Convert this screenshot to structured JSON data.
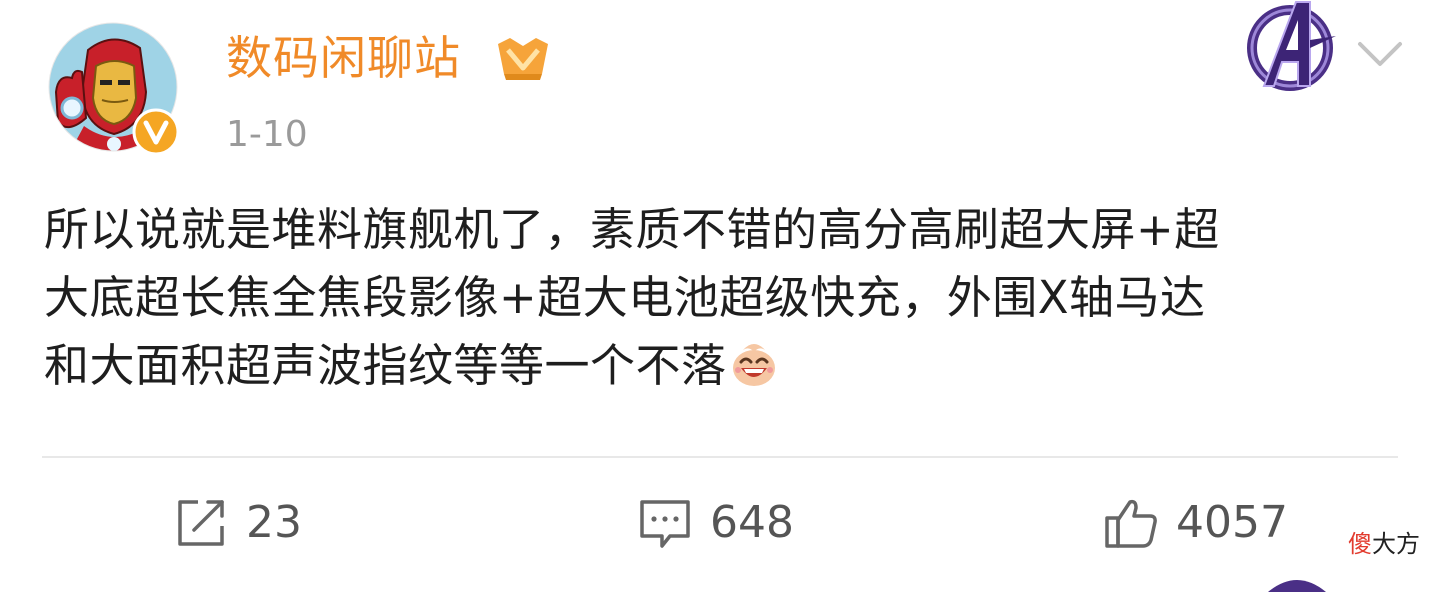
{
  "post": {
    "author": {
      "name": "数码闲聊站",
      "avatar_icon": "iron-man-avatar",
      "verified_badge_icon": "verified-v-badge",
      "vip_icon": "vip-crown-icon"
    },
    "timestamp": "1-10",
    "header_badge_icon": "avengers-logo-badge",
    "menu_icon": "chevron-down-icon",
    "content_lines": [
      "所以说就是堆料旗舰机了，素质不错的高分高刷超大屏+超",
      "大底超长焦全焦段影像+超大电池超级快充，外围X轴马达",
      "和大面积超声波指纹等等一个不落"
    ],
    "content_emoji_icon": "laughing-face-emoji",
    "actions": {
      "repost": {
        "icon": "share-icon",
        "count": "23"
      },
      "comment": {
        "icon": "comment-icon",
        "count": "648"
      },
      "like": {
        "icon": "thumbs-up-icon",
        "count": "4057"
      }
    }
  },
  "watermark": {
    "first_char": "傻",
    "rest": "大方"
  },
  "colors": {
    "username": "#f08a28",
    "timestamp": "#9a9a9a",
    "body_text": "#1e1e1e",
    "action_text": "#555555",
    "divider": "#e8e8e8",
    "watermark_accent": "#e23b2e"
  }
}
